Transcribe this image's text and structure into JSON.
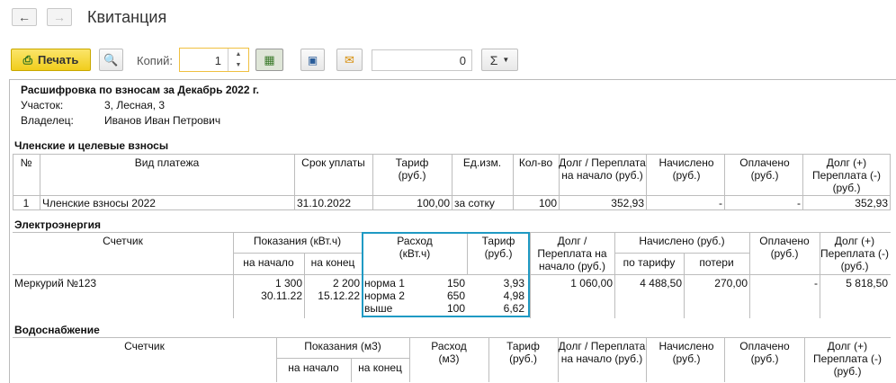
{
  "window": {
    "title": "Квитанция"
  },
  "toolbar": {
    "print_label": "Печать",
    "copies_label": "Копий:",
    "copies_value": "1",
    "sum_value": "0",
    "sum_symbol": "Σ"
  },
  "report": {
    "header": "Расшифровка по взносам за Декабрь 2022 г.",
    "plot_label": "Участок:",
    "plot_value": "3, Лесная, 3",
    "owner_label": "Владелец:",
    "owner_value": "Иванов Иван Петрович",
    "membership": {
      "title": "Членские и целевые взносы",
      "headers": [
        "№",
        "Вид платежа",
        "Срок уплаты",
        "Тариф (руб.)",
        "Ед.изм.",
        "Кол-во",
        "Долг / Переплата на начало (руб.)",
        "Начислено (руб.)",
        "Оплачено (руб.)",
        "Долг (+) Переплата (-) (руб.)"
      ],
      "row": [
        "1",
        "Членские взносы 2022",
        "31.10.2022",
        "100,00",
        "за сотку",
        "100",
        "352,93",
        "-",
        "-",
        "352,93"
      ]
    },
    "electric": {
      "title": "Электроэнергия",
      "h_meter": "Счетчик",
      "h_readings": "Показания (кВт.ч)",
      "h_start": "на начало",
      "h_end": "на конец",
      "h_usage": "Расход (кВт.ч)",
      "h_tariff": "Тариф (руб.)",
      "h_debt": "Долг / Переплата на начало (руб.)",
      "h_charged": "Начислено (руб.)",
      "h_by_tariff": "по тарифу",
      "h_losses": "потери",
      "h_paid": "Оплачено (руб.)",
      "h_balance": "Долг (+) Переплата (-) (руб.)",
      "meter": "Меркурий №123",
      "start_val": "1 300",
      "start_date": "30.11.22",
      "end_val": "2 200",
      "end_date": "15.12.22",
      "tiers": [
        {
          "name": "норма 1",
          "usage": "150",
          "tariff": "3,93"
        },
        {
          "name": "норма 2",
          "usage": "650",
          "tariff": "4,98"
        },
        {
          "name": "выше",
          "usage": "100",
          "tariff": "6,62"
        }
      ],
      "debt": "1 060,00",
      "by_tariff": "4 488,50",
      "losses": "270,00",
      "paid": "-",
      "balance": "5 818,50"
    },
    "water": {
      "title": "Водоснабжение",
      "h_meter": "Счетчик",
      "h_readings": "Показания (м3)",
      "h_start": "на начало",
      "h_end": "на конец",
      "h_usage": "Расход (м3)",
      "h_tariff": "Тариф (руб.)",
      "h_debt": "Долг / Переплата на начало (руб.)",
      "h_charged": "Начислено (руб.)",
      "h_paid": "Оплачено (руб.)",
      "h_balance": "Долг (+) Переплата (-) (руб.)"
    }
  }
}
